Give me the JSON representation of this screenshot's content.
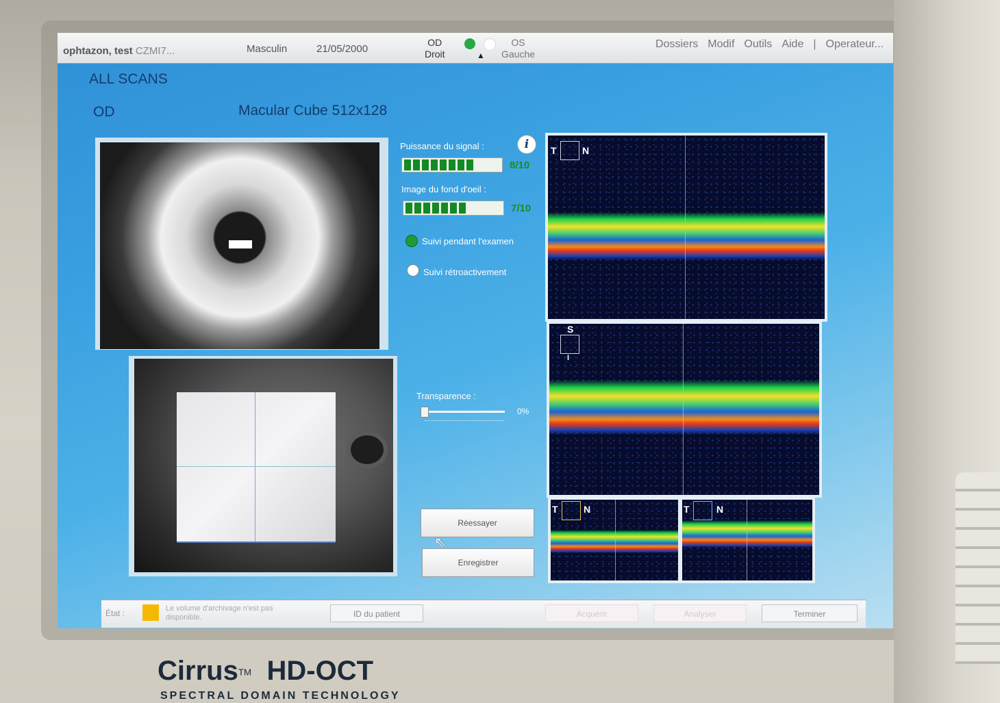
{
  "menubar": {
    "patient_name": "ophtazon, test",
    "patient_id": "CZMI7...",
    "sex": "Masculin",
    "dob": "21/05/2000",
    "od_top": "OD",
    "od_bottom": "Droit",
    "os_top": "OS",
    "os_bottom": "Gauche",
    "menus": [
      "Dossiers",
      "Modif",
      "Outils",
      "Aide",
      "|",
      "Operateur..."
    ]
  },
  "header": {
    "section": "ALL SCANS",
    "eye": "OD",
    "scan_type": "Macular Cube 512x128"
  },
  "quality": {
    "signal_label": "Puissance du signal :",
    "signal_value": "8/10",
    "signal_level": 8,
    "fundus_label": "Image du fond d'oeil :",
    "fundus_value": "7/10",
    "fundus_level": 7,
    "tracking_live": "Suivi pendant l'examen",
    "tracking_retro": "Suivi rétroactivement"
  },
  "transparency": {
    "label": "Transparence :",
    "value": "0%",
    "level": 0
  },
  "buttons": {
    "retry": "Réessayer",
    "save": "Enregistrer"
  },
  "oct": {
    "label_t": "T",
    "label_n": "N",
    "label_s": "S",
    "label_i": "I"
  },
  "status": {
    "label": "État :",
    "message": "Le volume d'archivage n'est pas disponible.",
    "patient_id_btn": "ID du patient",
    "acquire_btn": "Acquérir",
    "analyze_btn": "Analyser",
    "finish_btn": "Terminer"
  },
  "brand": {
    "name": "Cirrus",
    "tm": "TM",
    "model": "HD-OCT",
    "subtitle": "SPECTRAL DOMAIN TECHNOLOGY"
  },
  "colors": {
    "accent_green": "#1c8c24",
    "status_warning": "#f5b800",
    "screen_blue": "#3aa0e0"
  }
}
